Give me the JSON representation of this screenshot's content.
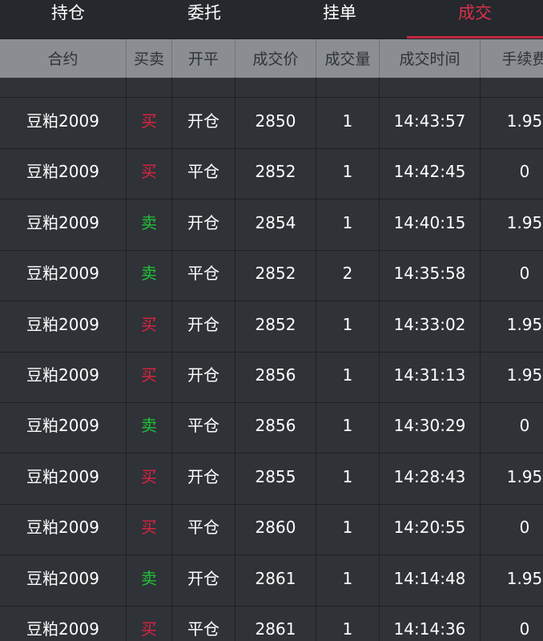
{
  "tabs": [
    {
      "label": "持仓"
    },
    {
      "label": "委托"
    },
    {
      "label": "挂单"
    },
    {
      "label": "成交"
    }
  ],
  "active_tab": "成交",
  "colors": {
    "accent": "#d9324a",
    "buy": "#e0233f",
    "sell": "#22c33a",
    "header_bg": "#8a8e93",
    "body_bg": "#2f3237"
  },
  "table": {
    "headers": [
      "合约",
      "买卖",
      "开平",
      "成交价",
      "成交量",
      "成交时间",
      "手续费"
    ],
    "rows": [
      {
        "contract": "豆粕2009",
        "side": "买",
        "side_type": "buy",
        "open_close": "开仓",
        "price": "2850",
        "volume": "1",
        "time": "14:43:57",
        "fee": "1.95"
      },
      {
        "contract": "豆粕2009",
        "side": "买",
        "side_type": "buy",
        "open_close": "平仓",
        "price": "2852",
        "volume": "1",
        "time": "14:42:45",
        "fee": "0"
      },
      {
        "contract": "豆粕2009",
        "side": "卖",
        "side_type": "sell",
        "open_close": "开仓",
        "price": "2854",
        "volume": "1",
        "time": "14:40:15",
        "fee": "1.95"
      },
      {
        "contract": "豆粕2009",
        "side": "卖",
        "side_type": "sell",
        "open_close": "平仓",
        "price": "2852",
        "volume": "2",
        "time": "14:35:58",
        "fee": "0"
      },
      {
        "contract": "豆粕2009",
        "side": "买",
        "side_type": "buy",
        "open_close": "开仓",
        "price": "2852",
        "volume": "1",
        "time": "14:33:02",
        "fee": "1.95"
      },
      {
        "contract": "豆粕2009",
        "side": "买",
        "side_type": "buy",
        "open_close": "开仓",
        "price": "2856",
        "volume": "1",
        "time": "14:31:13",
        "fee": "1.95"
      },
      {
        "contract": "豆粕2009",
        "side": "卖",
        "side_type": "sell",
        "open_close": "平仓",
        "price": "2856",
        "volume": "1",
        "time": "14:30:29",
        "fee": "0"
      },
      {
        "contract": "豆粕2009",
        "side": "买",
        "side_type": "buy",
        "open_close": "开仓",
        "price": "2855",
        "volume": "1",
        "time": "14:28:43",
        "fee": "1.95"
      },
      {
        "contract": "豆粕2009",
        "side": "买",
        "side_type": "buy",
        "open_close": "平仓",
        "price": "2860",
        "volume": "1",
        "time": "14:20:55",
        "fee": "0"
      },
      {
        "contract": "豆粕2009",
        "side": "卖",
        "side_type": "sell",
        "open_close": "开仓",
        "price": "2861",
        "volume": "1",
        "time": "14:14:48",
        "fee": "1.95"
      },
      {
        "contract": "豆粕2009",
        "side": "买",
        "side_type": "buy",
        "open_close": "平仓",
        "price": "2861",
        "volume": "1",
        "time": "14:14:36",
        "fee": "0"
      }
    ]
  }
}
